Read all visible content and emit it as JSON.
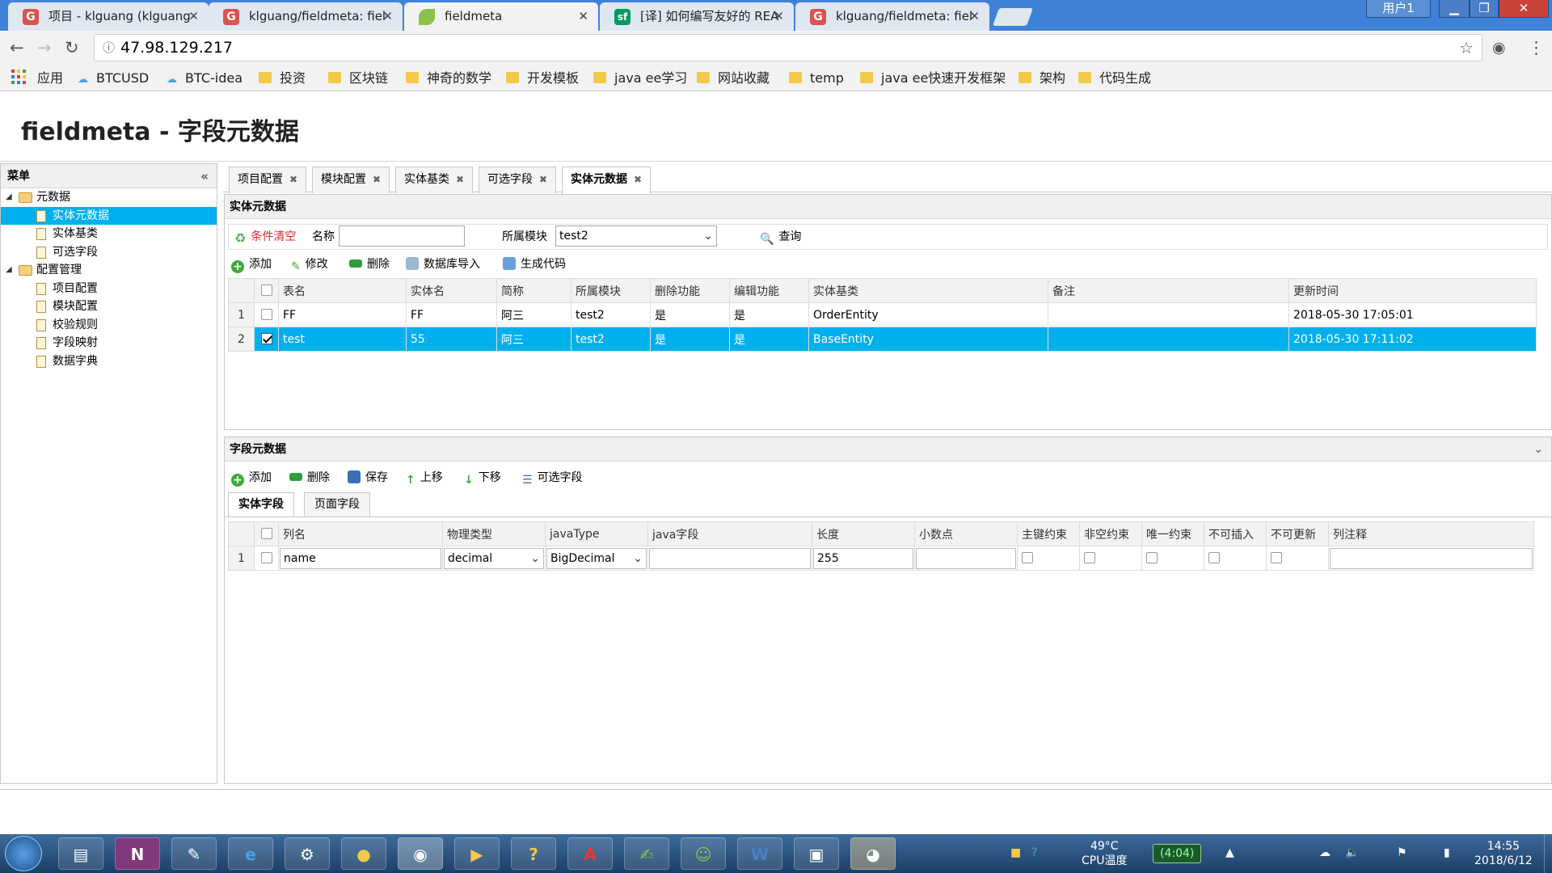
{
  "browser": {
    "tabs": [
      {
        "title": "项目 - klguang (klguang",
        "icon": "G",
        "icon_color": "#d9534f"
      },
      {
        "title": "klguang/fieldmeta: fiel",
        "icon": "G",
        "icon_color": "#d9534f"
      },
      {
        "title": "fieldmeta",
        "icon": "leaf",
        "icon_color": "#8bc34a"
      },
      {
        "title": "[译] 如何编写友好的 REA",
        "icon": "sf",
        "icon_color": "#009a61"
      },
      {
        "title": "klguang/fieldmeta: fiel",
        "icon": "G",
        "icon_color": "#d9534f"
      }
    ],
    "user_label": "用户1",
    "url": "47.98.129.217",
    "bookmarks": [
      "应用",
      "BTCUSD",
      "BTC-idea",
      "投资",
      "区块链",
      "神奇的数学",
      "开发模板",
      "java ee学习",
      "网站收藏",
      "temp",
      "java ee快速开发框架",
      "架构",
      "代码生成"
    ]
  },
  "page": {
    "title": "fieldmeta - 字段元数据"
  },
  "sidebar": {
    "header": "菜单",
    "groups": [
      {
        "label": "元数据",
        "items": [
          "实体元数据",
          "实体基类",
          "可选字段"
        ]
      },
      {
        "label": "配置管理",
        "items": [
          "项目配置",
          "模块配置",
          "校验规则",
          "字段映射",
          "数据字典"
        ]
      }
    ],
    "selected": "实体元数据"
  },
  "tabs": [
    "项目配置",
    "模块配置",
    "实体基类",
    "可选字段",
    "实体元数据"
  ],
  "entity_panel": {
    "title": "实体元数据",
    "clear_label": "条件清空",
    "name_label": "名称",
    "name_value": "",
    "module_label": "所属模块",
    "module_value": "test2",
    "query_label": "查询",
    "toolbar": [
      "添加",
      "修改",
      "删除",
      "数据库导入",
      "生成代码"
    ],
    "columns": [
      "表名",
      "实体名",
      "简称",
      "所属模块",
      "删除功能",
      "编辑功能",
      "实体基类",
      "备注",
      "更新时间"
    ],
    "rows": [
      {
        "num": "1",
        "checked": false,
        "cells": [
          "FF",
          "FF",
          "阿三",
          "test2",
          "是",
          "是",
          "OrderEntity",
          "",
          "2018-05-30 17:05:01"
        ]
      },
      {
        "num": "2",
        "checked": true,
        "cells": [
          "test",
          "55",
          "阿三",
          "test2",
          "是",
          "是",
          "BaseEntity",
          "",
          "2018-05-30 17:11:02"
        ]
      }
    ]
  },
  "field_panel": {
    "title": "字段元数据",
    "toolbar": [
      "添加",
      "删除",
      "保存",
      "上移",
      "下移",
      "可选字段"
    ],
    "subtabs": [
      "实体字段",
      "页面字段"
    ],
    "columns": [
      "列名",
      "物理类型",
      "javaType",
      "java字段",
      "长度",
      "小数点",
      "主键约束",
      "非空约束",
      "唯一约束",
      "不可插入",
      "不可更新",
      "列注释"
    ],
    "rows": [
      {
        "num": "1",
        "name": "name",
        "physical_type": "decimal",
        "java_type": "BigDecimal",
        "java_field": "",
        "length": "255",
        "decimal": "",
        "comment": ""
      }
    ]
  },
  "taskbar": {
    "temperature": "49°C",
    "temperature_label": "CPU温度",
    "battery": "(4:04)",
    "time": "14:55",
    "date": "2018/6/12"
  }
}
